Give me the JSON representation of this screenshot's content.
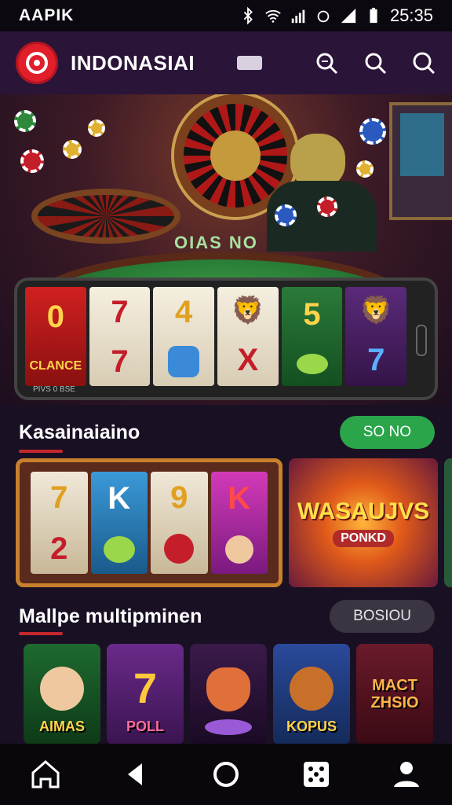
{
  "status_bar": {
    "carrier": "AAPIK",
    "time": "25:35"
  },
  "header": {
    "title": "INDONASIAI"
  },
  "hero": {
    "table_label": "OIAS NO",
    "reels": [
      "0",
      "7",
      "4",
      "🦁",
      "5",
      "🦁"
    ],
    "reels_bottom": [
      "",
      "7",
      "",
      "X",
      "",
      "7"
    ],
    "reel_caption": "CLANCE",
    "footer_text": "PIVS 0 BSE"
  },
  "section1": {
    "title": "Kasainaiaino",
    "button": "SO NO"
  },
  "featured": {
    "reels_top": [
      "7",
      "K",
      "9",
      "K"
    ],
    "reels_bottom": [
      "2",
      "",
      "",
      ""
    ],
    "promo_title": "WASAUJVS",
    "promo_sub": "PONKD"
  },
  "section2": {
    "title": "Mallpe multipminen",
    "button": "BOSIOU"
  },
  "games": [
    {
      "label": "AIMAS"
    },
    {
      "label": "POLL",
      "glyph": "7"
    },
    {
      "label": ""
    },
    {
      "label": "KOPUS"
    },
    {
      "label": "MACT ZHSIO"
    }
  ],
  "colors": {
    "accent_red": "#e01f2b",
    "accent_green": "#2aa54a",
    "header_bg": "#2a1438"
  },
  "icons": {
    "header": [
      "ticket-icon",
      "search-zoom-icon",
      "search-icon",
      "search-icon"
    ],
    "nav": [
      "home-icon",
      "back-icon",
      "circle-icon",
      "apps-icon",
      "profile-icon"
    ]
  }
}
